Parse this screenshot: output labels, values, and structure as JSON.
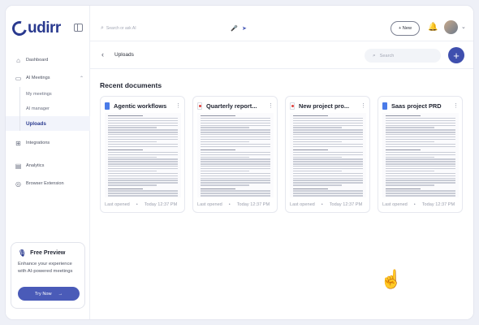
{
  "app": {
    "logo_text": "udirr",
    "brand_color": "#2a3a8f",
    "accent_color": "#4a5bb8"
  },
  "sidebar": {
    "items": [
      {
        "label": "Dashboard",
        "icon": "home-icon"
      },
      {
        "label": "AI Meetings",
        "icon": "meetings-icon",
        "expanded": true
      },
      {
        "label": "Integrations",
        "icon": "puzzle-icon"
      },
      {
        "label": "Analytics",
        "icon": "chart-icon"
      },
      {
        "label": "Browser Extension",
        "icon": "globe-icon"
      }
    ],
    "subitems": [
      {
        "label": "My meetings"
      },
      {
        "label": "AI manager"
      },
      {
        "label": "Uploads",
        "active": true
      }
    ],
    "promo": {
      "title": "Free Preview",
      "text": "Enhance your experience with AI-powered meetings",
      "button": "Try Now"
    }
  },
  "topbar": {
    "search_placeholder": "Search or ask AI",
    "new_button": "+ New"
  },
  "subheader": {
    "title": "Uploads",
    "search_placeholder": "Search",
    "add_label": "+"
  },
  "main": {
    "section_title": "Recent documents",
    "documents": [
      {
        "title": "Agentic workflows",
        "type": "gdoc",
        "meta_label": "Last opened",
        "meta_time": "Today 12:37 PM"
      },
      {
        "title": "Quarterly report...",
        "type": "pdf",
        "meta_label": "Last opened",
        "meta_time": "Today 12:37 PM"
      },
      {
        "title": "New project pro...",
        "type": "pdf",
        "meta_label": "Last opened",
        "meta_time": "Today 12:37 PM"
      },
      {
        "title": "Saas project PRD",
        "type": "gdoc",
        "meta_label": "Last opened",
        "meta_time": "Today 12:37 PM"
      }
    ]
  }
}
